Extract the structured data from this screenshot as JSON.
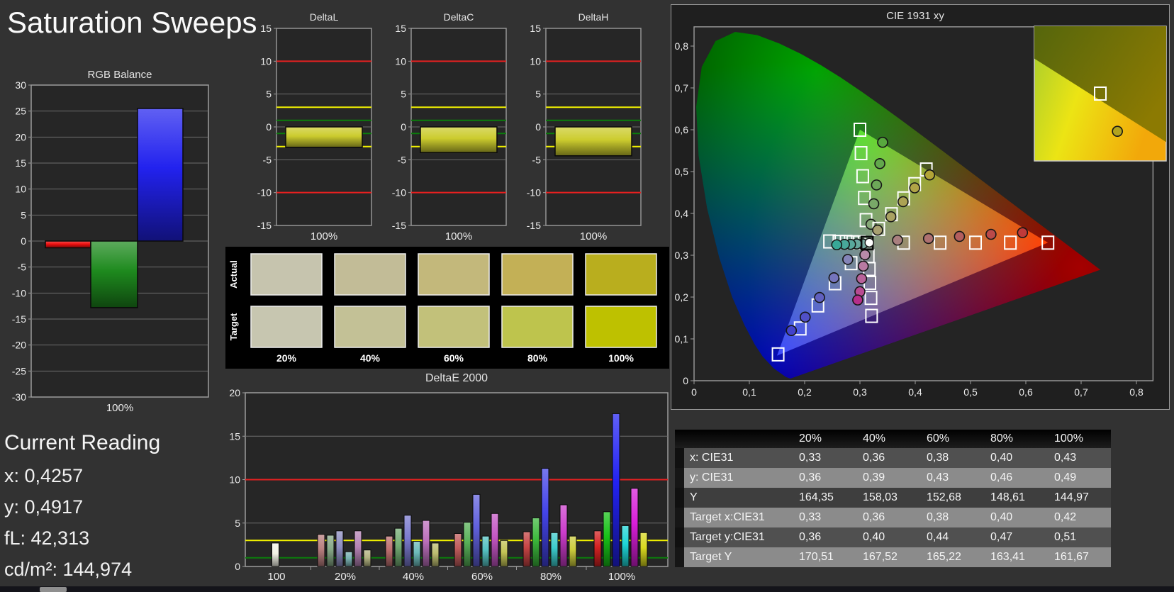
{
  "page": {
    "title": "Saturation Sweeps"
  },
  "rgb_balance": {
    "title": "RGB Balance",
    "xlabel": "100%",
    "ylim": [
      -30,
      30
    ],
    "tick_labels": [
      "30",
      "25",
      "20",
      "15",
      "10",
      "5",
      "0",
      "-5",
      "-10",
      "-15",
      "-20",
      "-25",
      "-30"
    ],
    "series": [
      {
        "name": "red",
        "value": -1.3,
        "color": "#ee1010"
      },
      {
        "name": "green",
        "value": -12.8,
        "color": "#1e8a1e"
      },
      {
        "name": "blue",
        "value": 25.5,
        "color": "#2222ee"
      }
    ]
  },
  "delta_charts": {
    "shared": {
      "xlabel": "100%",
      "ylim": [
        -15,
        15
      ],
      "tick_labels": [
        "15",
        "10",
        "5",
        "0",
        "-5",
        "-10",
        "-15"
      ],
      "ref_red": 10,
      "ref_yellow": 3,
      "ref_green": 1,
      "bar_color": "#cccc2e",
      "ref_red_color": "#e62020",
      "ref_yellow_color": "#f2f200",
      "ref_green_color": "#0b7d0b"
    },
    "charts": [
      {
        "title": "DeltaL",
        "value": -3.1
      },
      {
        "title": "DeltaC",
        "value": -3.9
      },
      {
        "title": "DeltaH",
        "value": -4.4
      }
    ]
  },
  "swatches": {
    "row_labels": [
      "Actual",
      "Target"
    ],
    "col_labels": [
      "20%",
      "40%",
      "60%",
      "80%",
      "100%"
    ],
    "actual_colors": [
      "#c6c4ae",
      "#c2bc97",
      "#c3b87b",
      "#c3b056",
      "#b9ae1e"
    ],
    "target_colors": [
      "#c7c6b0",
      "#c3c196",
      "#c2c17a",
      "#bec44d",
      "#bec100"
    ]
  },
  "deltae": {
    "title": "DeltaE 2000",
    "ylim": [
      0,
      20
    ],
    "tick_labels": [
      "20",
      "15",
      "10",
      "5",
      "0"
    ],
    "ref_red": 10,
    "ref_yellow": 3,
    "ref_green": 1,
    "groups": [
      {
        "label": "100",
        "values": [
          2.7
        ],
        "colors": [
          "#f2f2e6"
        ]
      },
      {
        "label": "20%",
        "values": [
          3.7,
          3.6,
          4.1,
          1.7,
          4.1,
          1.9
        ],
        "colors": [
          "#b97f7f",
          "#86a886",
          "#8d8dc1",
          "#79b2b2",
          "#b583b5",
          "#b5b583"
        ]
      },
      {
        "label": "40%",
        "values": [
          3.5,
          4.4,
          5.9,
          2.9,
          5.3,
          2.7
        ],
        "colors": [
          "#bd6f6f",
          "#74ad74",
          "#7a7ace",
          "#6cbaba",
          "#bc6fbc",
          "#bcbc6f"
        ]
      },
      {
        "label": "60%",
        "values": [
          3.8,
          5.1,
          8.3,
          3.5,
          6.1,
          3.0
        ],
        "colors": [
          "#c05b5b",
          "#58b158",
          "#6161dd",
          "#55c3c3",
          "#c455c4",
          "#c4c455"
        ]
      },
      {
        "label": "80%",
        "values": [
          4.0,
          5.6,
          11.3,
          3.9,
          7.1,
          3.5
        ],
        "colors": [
          "#c64444",
          "#3cb83c",
          "#4444e8",
          "#3ccccc",
          "#cc3ccc",
          "#cccc3c"
        ]
      },
      {
        "label": "100%",
        "values": [
          4.1,
          6.3,
          17.6,
          4.7,
          9.0,
          3.9
        ],
        "colors": [
          "#d42222",
          "#18c218",
          "#2222f2",
          "#1ed6d6",
          "#d81ed8",
          "#d8d81e"
        ]
      }
    ]
  },
  "cie": {
    "title": "CIE 1931 xy",
    "x_tick_labels": [
      "0",
      "0,1",
      "0,2",
      "0,3",
      "0,4",
      "0,5",
      "0,6",
      "0,7",
      "0,8"
    ],
    "y_tick_labels": [
      "0",
      "0,1",
      "0,2",
      "0,3",
      "0,4",
      "0,5",
      "0,6",
      "0,7",
      "0,8"
    ],
    "white_point": {
      "target": [
        0.313,
        0.329
      ],
      "measured": [
        0.317,
        0.33
      ]
    },
    "sweeps": [
      {
        "name": "red",
        "targets": [
          [
            0.379,
            0.33
          ],
          [
            0.445,
            0.33
          ],
          [
            0.509,
            0.33
          ],
          [
            0.572,
            0.33
          ],
          [
            0.64,
            0.33
          ]
        ],
        "measured": [
          [
            0.368,
            0.336
          ],
          [
            0.424,
            0.34
          ],
          [
            0.48,
            0.345
          ],
          [
            0.537,
            0.35
          ],
          [
            0.594,
            0.354
          ]
        ],
        "dot_colors": [
          "#a97f7f",
          "#ae7070",
          "#b45e5e",
          "#ba4a4a",
          "#c03a3a"
        ]
      },
      {
        "name": "green",
        "targets": [
          [
            0.311,
            0.384
          ],
          [
            0.308,
            0.437
          ],
          [
            0.305,
            0.489
          ],
          [
            0.302,
            0.544
          ],
          [
            0.3,
            0.6
          ]
        ],
        "measured": [
          [
            0.32,
            0.374
          ],
          [
            0.325,
            0.423
          ],
          [
            0.33,
            0.468
          ],
          [
            0.336,
            0.519
          ],
          [
            0.341,
            0.57
          ]
        ],
        "dot_colors": [
          "#86a878",
          "#79a868",
          "#6da858",
          "#62a84c",
          "#58a83e"
        ]
      },
      {
        "name": "blue",
        "targets": [
          [
            0.284,
            0.281
          ],
          [
            0.255,
            0.233
          ],
          [
            0.224,
            0.18
          ],
          [
            0.192,
            0.125
          ],
          [
            0.152,
            0.063
          ]
        ],
        "measured": [
          [
            0.278,
            0.29
          ],
          [
            0.253,
            0.246
          ],
          [
            0.227,
            0.199
          ],
          [
            0.201,
            0.152
          ],
          [
            0.176,
            0.12
          ]
        ],
        "dot_colors": [
          "#8484b8",
          "#7474bc",
          "#6060c0",
          "#5050c6",
          "#4242cc"
        ]
      },
      {
        "name": "cyan",
        "targets": [
          [
            0.299,
            0.331
          ],
          [
            0.287,
            0.331
          ],
          [
            0.275,
            0.332
          ],
          [
            0.262,
            0.332
          ],
          [
            0.245,
            0.333
          ]
        ],
        "measured": [
          [
            0.305,
            0.327
          ],
          [
            0.294,
            0.327
          ],
          [
            0.283,
            0.326
          ],
          [
            0.272,
            0.326
          ],
          [
            0.258,
            0.325
          ]
        ],
        "dot_colors": [
          "#78a8a0",
          "#68a89e",
          "#58a89c",
          "#48a89a",
          "#38a898"
        ]
      },
      {
        "name": "magenta",
        "targets": [
          [
            0.315,
            0.298
          ],
          [
            0.317,
            0.267
          ],
          [
            0.318,
            0.234
          ],
          [
            0.32,
            0.198
          ],
          [
            0.321,
            0.155
          ]
        ],
        "measured": [
          [
            0.309,
            0.301
          ],
          [
            0.306,
            0.274
          ],
          [
            0.303,
            0.244
          ],
          [
            0.3,
            0.213
          ],
          [
            0.296,
            0.193
          ]
        ],
        "dot_colors": [
          "#b88aa8",
          "#b87aa2",
          "#b8629a",
          "#b84a92",
          "#b62e8a"
        ]
      },
      {
        "name": "yellow",
        "targets": [
          [
            0.334,
            0.363
          ],
          [
            0.357,
            0.398
          ],
          [
            0.379,
            0.436
          ],
          [
            0.399,
            0.47
          ],
          [
            0.42,
            0.505
          ]
        ],
        "measured": [
          [
            0.332,
            0.36
          ],
          [
            0.356,
            0.392
          ],
          [
            0.378,
            0.428
          ],
          [
            0.399,
            0.461
          ],
          [
            0.426,
            0.492
          ]
        ],
        "dot_colors": [
          "#a8a070",
          "#aaa262",
          "#aca254",
          "#b0a446",
          "#b2a436"
        ]
      }
    ],
    "inset": {
      "square": [
        0.5,
        0.5
      ],
      "circle": [
        0.63,
        0.78
      ],
      "circle_color": "#b2a41e"
    }
  },
  "table": {
    "col_headers": [
      "",
      "20%",
      "40%",
      "60%",
      "80%",
      "100%"
    ],
    "rows": [
      {
        "label": "x: CIE31",
        "shade": "r-dark",
        "values": [
          "0,33",
          "0,36",
          "0,38",
          "0,40",
          "0,43"
        ]
      },
      {
        "label": "y: CIE31",
        "shade": "r-light",
        "values": [
          "0,36",
          "0,39",
          "0,43",
          "0,46",
          "0,49"
        ]
      },
      {
        "label": "Y",
        "shade": "r-darker",
        "values": [
          "164,35",
          "158,03",
          "152,68",
          "148,61",
          "144,97"
        ]
      },
      {
        "label": "Target x:CIE31",
        "shade": "r-light",
        "values": [
          "0,33",
          "0,36",
          "0,38",
          "0,40",
          "0,42"
        ]
      },
      {
        "label": "Target y:CIE31",
        "shade": "r-dark",
        "values": [
          "0,36",
          "0,40",
          "0,44",
          "0,47",
          "0,51"
        ]
      },
      {
        "label": "Target Y",
        "shade": "r-light",
        "values": [
          "170,51",
          "167,52",
          "165,22",
          "163,41",
          "161,67"
        ]
      }
    ]
  },
  "current_reading": {
    "title": "Current Reading",
    "lines": [
      "x: 0,4257",
      "y: 0,4917",
      "fL: 42,313",
      "cd/m²: 144,974"
    ]
  }
}
